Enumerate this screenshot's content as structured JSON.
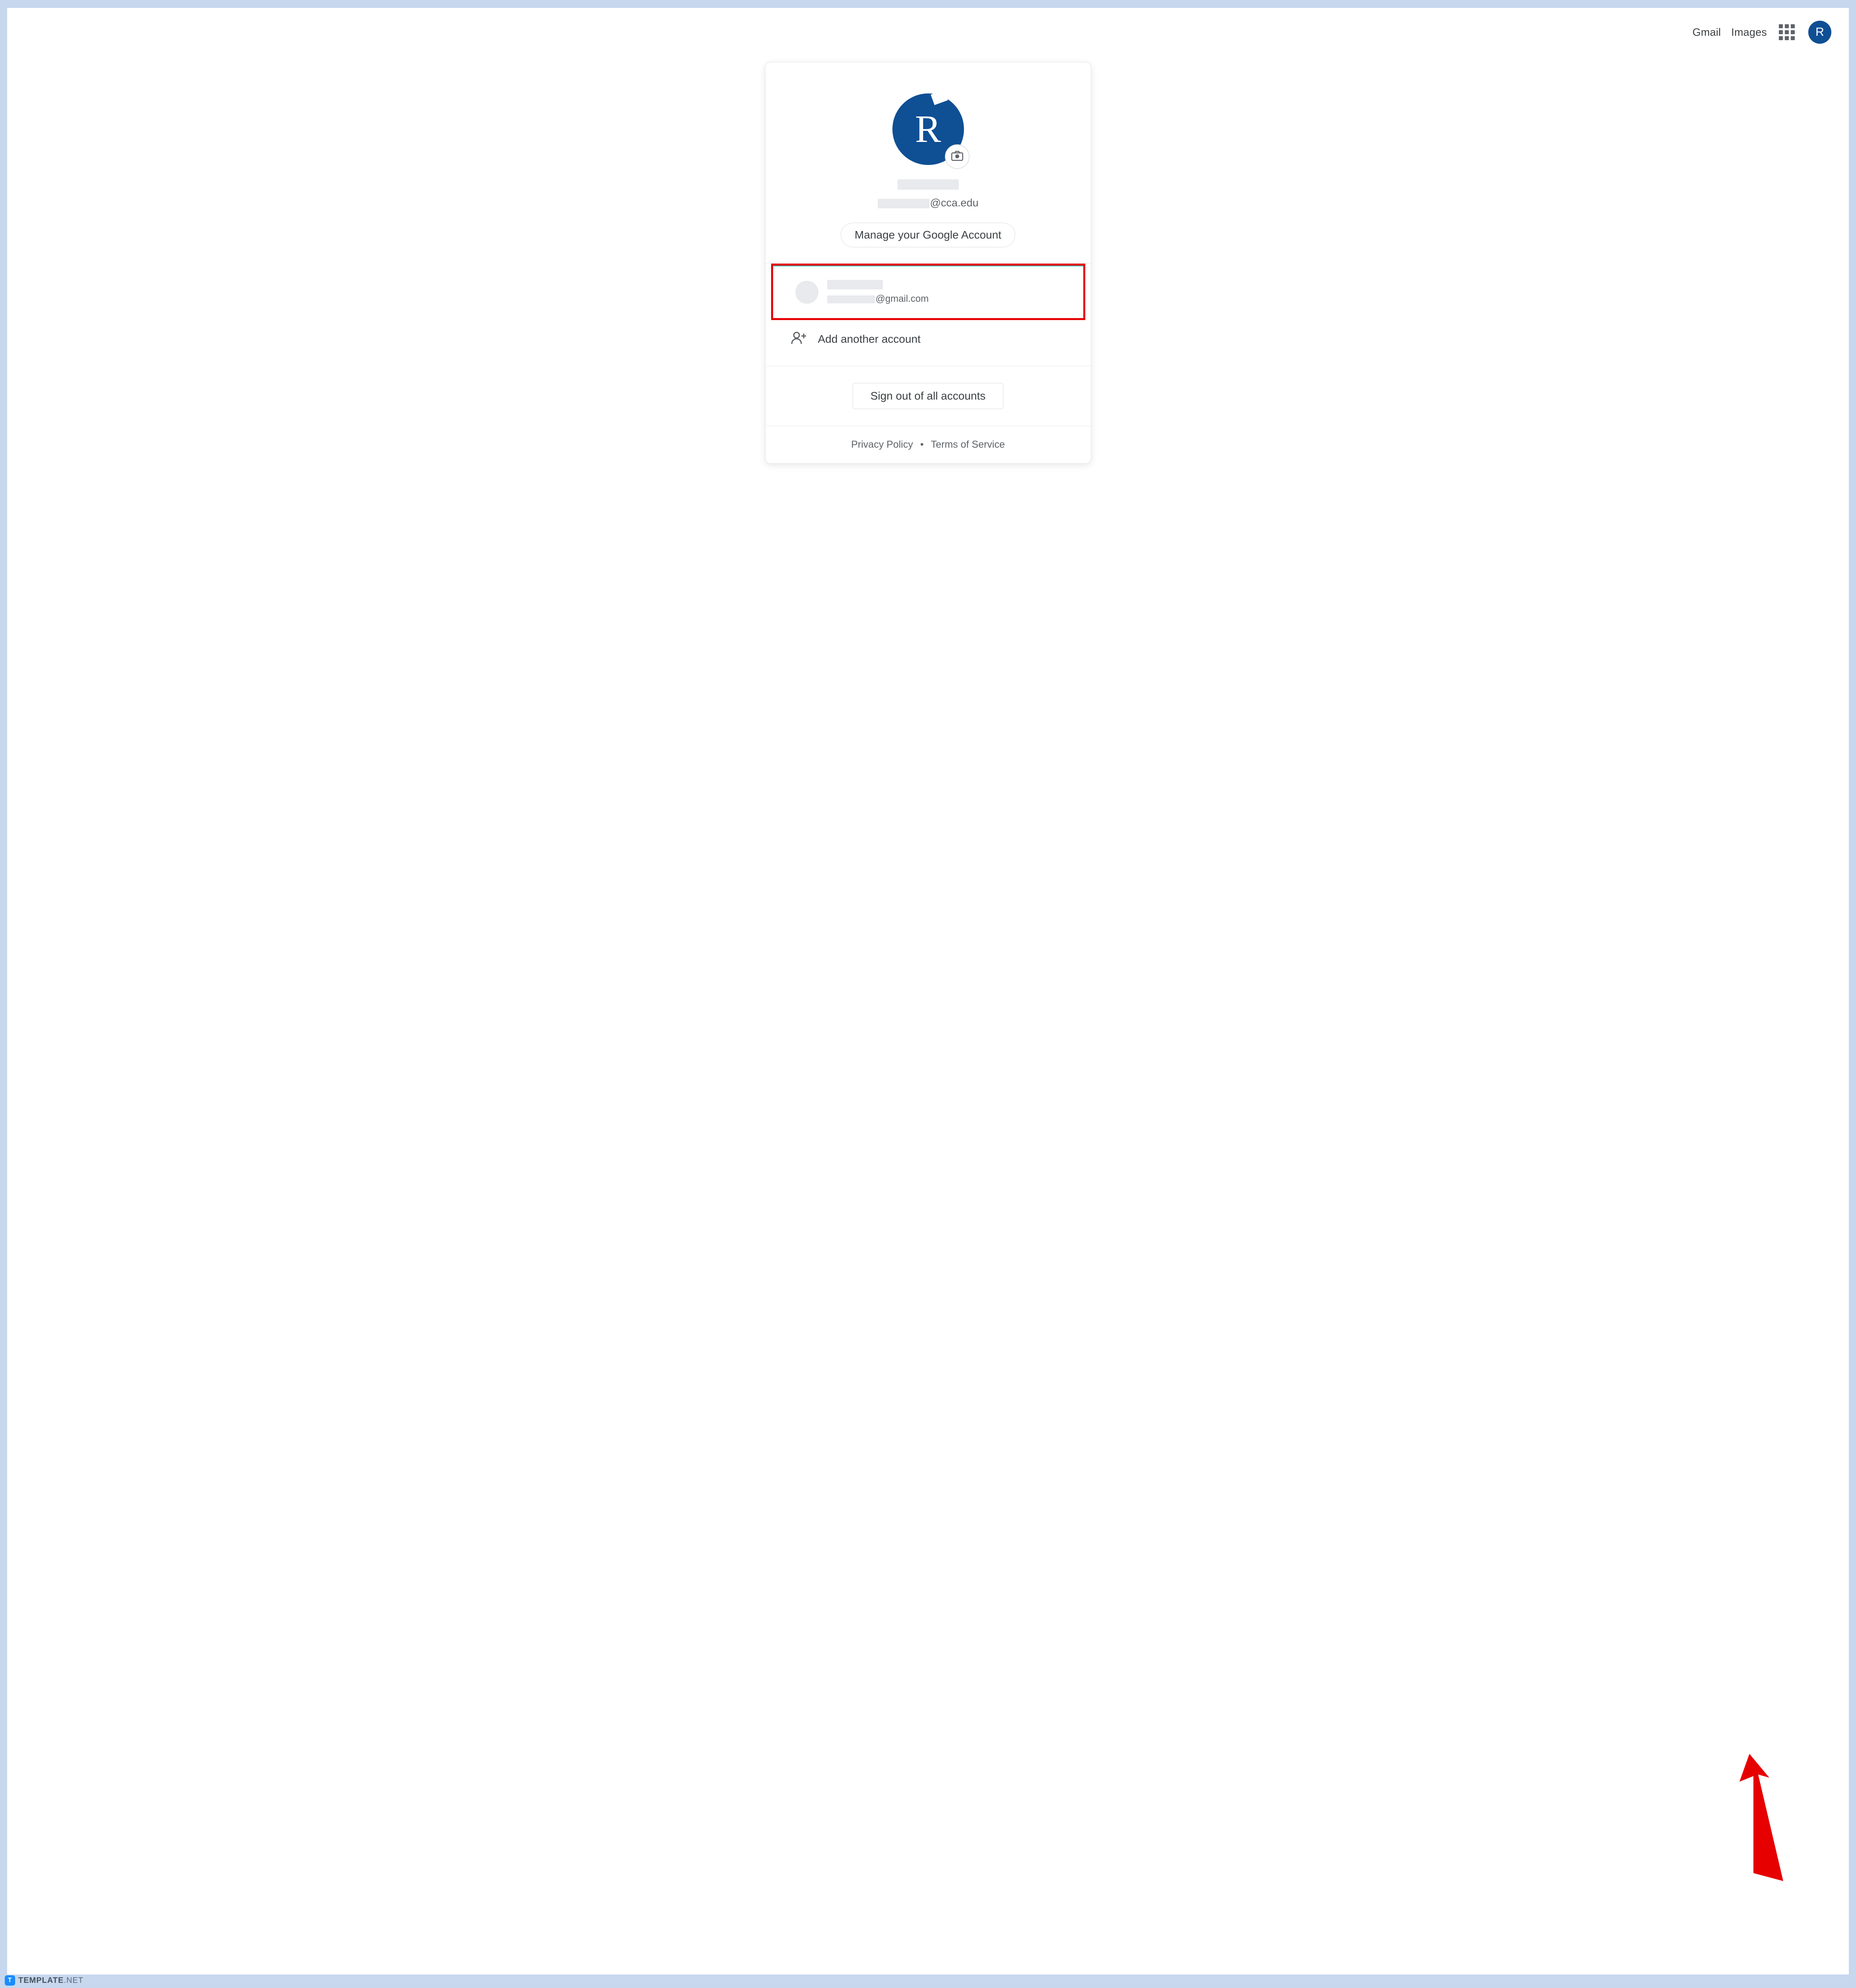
{
  "topbar": {
    "gmail": "Gmail",
    "images": "Images",
    "avatar_initial": "R"
  },
  "profile": {
    "avatar_initial": "R",
    "email_suffix": "@cca.edu",
    "manage_label": "Manage your Google Account"
  },
  "secondary_account": {
    "email_suffix": "@gmail.com"
  },
  "add_account_label": "Add another account",
  "signout_label": "Sign out of all accounts",
  "footer": {
    "privacy": "Privacy Policy",
    "separator": "•",
    "terms": "Terms of Service"
  },
  "watermark": {
    "badge": "T",
    "brand_bold": "TEMPLATE",
    "brand_rest": ".NET"
  },
  "colors": {
    "accent": "#0f4f94",
    "highlight": "#e60000"
  }
}
